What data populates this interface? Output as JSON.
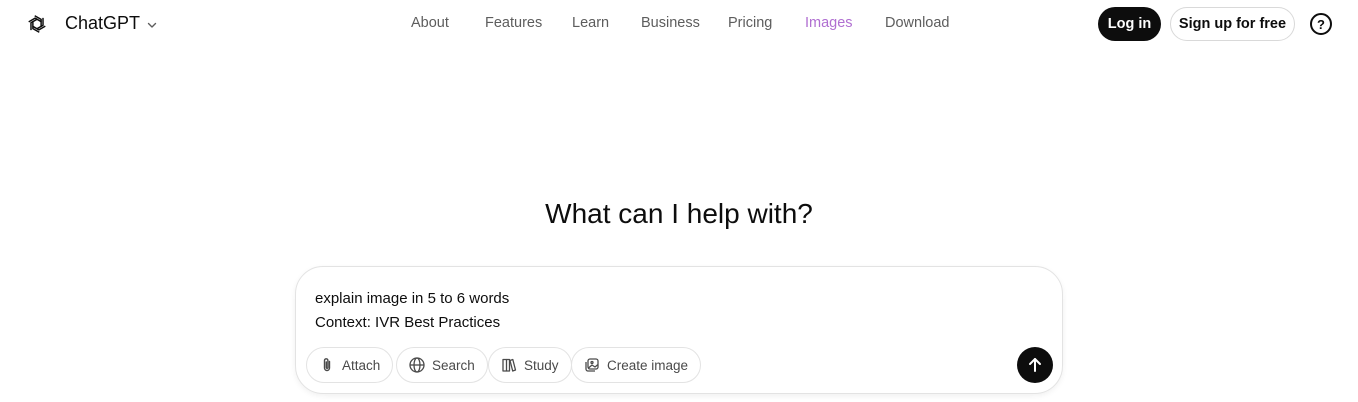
{
  "brand": {
    "name": "ChatGPT",
    "logo_icon": "openai-logo-icon",
    "dropdown_icon": "chevron-down-icon"
  },
  "nav": {
    "items": [
      {
        "label": "About"
      },
      {
        "label": "Features"
      },
      {
        "label": "Learn"
      },
      {
        "label": "Business"
      },
      {
        "label": "Pricing"
      },
      {
        "label": "Images",
        "active": true
      },
      {
        "label": "Download"
      }
    ],
    "active_color": "#b06fd1"
  },
  "auth": {
    "login_label": "Log in",
    "signup_label": "Sign up for free",
    "help_label": "?"
  },
  "main": {
    "heading": "What can I help with?",
    "prompt_lines": [
      "explain image in 5 to 6 words",
      "Context: IVR Best Practices"
    ],
    "tools": [
      {
        "label": "Attach",
        "icon": "paperclip-icon"
      },
      {
        "label": "Search",
        "icon": "globe-icon"
      },
      {
        "label": "Study",
        "icon": "book-icon"
      },
      {
        "label": "Create image",
        "icon": "image-create-icon"
      }
    ],
    "send_icon": "arrow-up-icon"
  }
}
